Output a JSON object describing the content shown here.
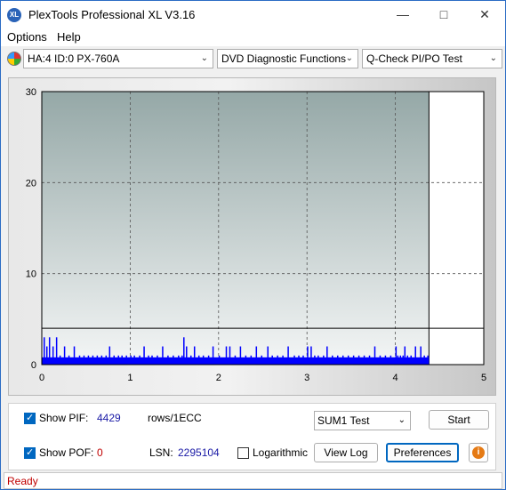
{
  "window": {
    "title": "PlexTools Professional XL V3.16",
    "app_icon_text": "XL"
  },
  "menu": {
    "items": [
      "Options",
      "Help"
    ]
  },
  "toolbar": {
    "drive": "HA:4 ID:0  PX-760A",
    "function": "DVD Diagnostic Functions",
    "test": "Q-Check PI/PO Test"
  },
  "chart_data": {
    "type": "bar",
    "title": "",
    "xlabel": "",
    "ylabel": "",
    "xlim": [
      0,
      5
    ],
    "ylim": [
      0,
      30
    ],
    "x_ticks": [
      "0",
      "1",
      "2",
      "3",
      "4",
      "5"
    ],
    "y_ticks": [
      "0",
      "10",
      "20",
      "30"
    ],
    "grid": true,
    "scan_end_x": 4.38,
    "threshold_y": 4,
    "series": [
      {
        "color": "#0000ff",
        "points": [
          [
            0.02,
            3
          ],
          [
            0.05,
            2
          ],
          [
            0.08,
            3
          ],
          [
            0.12,
            2
          ],
          [
            0.16,
            3
          ],
          [
            0.2,
            1
          ],
          [
            0.25,
            2
          ],
          [
            0.3,
            1
          ],
          [
            0.36,
            2
          ],
          [
            0.42,
            1
          ],
          [
            0.47,
            1
          ],
          [
            0.52,
            1
          ],
          [
            0.57,
            1
          ],
          [
            0.62,
            1
          ],
          [
            0.67,
            1
          ],
          [
            0.72,
            1
          ],
          [
            0.76,
            2
          ],
          [
            0.81,
            1
          ],
          [
            0.86,
            1
          ],
          [
            0.9,
            1
          ],
          [
            0.95,
            1
          ],
          [
            1.0,
            1
          ],
          [
            1.04,
            1
          ],
          [
            1.1,
            1
          ],
          [
            1.15,
            2
          ],
          [
            1.2,
            1
          ],
          [
            1.24,
            1
          ],
          [
            1.3,
            1
          ],
          [
            1.36,
            2
          ],
          [
            1.42,
            1
          ],
          [
            1.48,
            1
          ],
          [
            1.54,
            1
          ],
          [
            1.58,
            1
          ],
          [
            1.6,
            3
          ],
          [
            1.63,
            2
          ],
          [
            1.68,
            1
          ],
          [
            1.72,
            2
          ],
          [
            1.77,
            1
          ],
          [
            1.82,
            1
          ],
          [
            1.88,
            1
          ],
          [
            1.93,
            2
          ],
          [
            2.0,
            1
          ],
          [
            2.08,
            2
          ],
          [
            2.12,
            2
          ],
          [
            2.18,
            1
          ],
          [
            2.24,
            2
          ],
          [
            2.3,
            1
          ],
          [
            2.36,
            1
          ],
          [
            2.42,
            2
          ],
          [
            2.48,
            1
          ],
          [
            2.55,
            2
          ],
          [
            2.6,
            1
          ],
          [
            2.66,
            1
          ],
          [
            2.72,
            1
          ],
          [
            2.78,
            2
          ],
          [
            2.85,
            1
          ],
          [
            2.9,
            1
          ],
          [
            2.95,
            1
          ],
          [
            3.0,
            2
          ],
          [
            3.04,
            2
          ],
          [
            3.08,
            1
          ],
          [
            3.12,
            1
          ],
          [
            3.18,
            1
          ],
          [
            3.22,
            2
          ],
          [
            3.28,
            1
          ],
          [
            3.34,
            1
          ],
          [
            3.4,
            1
          ],
          [
            3.46,
            1
          ],
          [
            3.52,
            1
          ],
          [
            3.58,
            1
          ],
          [
            3.64,
            1
          ],
          [
            3.7,
            1
          ],
          [
            3.76,
            2
          ],
          [
            3.82,
            1
          ],
          [
            3.88,
            1
          ],
          [
            3.94,
            1
          ],
          [
            4.0,
            2
          ],
          [
            4.02,
            1
          ],
          [
            4.05,
            1
          ],
          [
            4.08,
            1
          ],
          [
            4.1,
            2
          ],
          [
            4.13,
            1
          ],
          [
            4.17,
            1
          ],
          [
            4.22,
            2
          ],
          [
            4.28,
            2
          ],
          [
            4.32,
            1
          ],
          [
            4.36,
            1
          ]
        ]
      }
    ]
  },
  "panel": {
    "show_pif_label": "Show PIF:",
    "pif_value": "4429",
    "pif_unit": "rows/1ECC",
    "show_pof_label": "Show POF:",
    "pof_value": "0",
    "lsn_label": "LSN:",
    "lsn_value": "2295104",
    "logarithmic_label": "Logarithmic",
    "sum_test": "SUM1 Test",
    "start_button": "Start",
    "view_log_button": "View Log",
    "preferences_button": "Preferences",
    "info_glyph": "i",
    "show_pif_checked": true,
    "show_pof_checked": true,
    "logarithmic_checked": false
  },
  "status": {
    "text": "Ready"
  },
  "colors": {
    "accent": "#0067c0",
    "status_text": "#c00000",
    "bars": "#0000ff"
  }
}
